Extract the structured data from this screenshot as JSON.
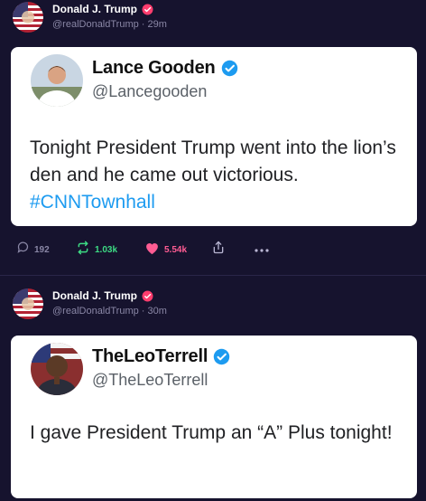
{
  "posts": [
    {
      "author": "Donald J. Trump",
      "handle": "@realDonaldTrump",
      "time": "29m",
      "card": {
        "name": "Lance Gooden",
        "handle": "@Lancegooden",
        "text": "Tonight President Trump went into the lion’s den and he came out victorious.",
        "hashtag": "#CNNTownhall"
      },
      "actions": {
        "replies": "192",
        "reposts": "1.03k",
        "likes": "5.54k"
      }
    },
    {
      "author": "Donald J. Trump",
      "handle": "@realDonaldTrump",
      "time": "30m",
      "card": {
        "name": "TheLeoTerrell",
        "handle": "@TheLeoTerrell",
        "text": "I gave President Trump an “A” Plus tonight!"
      }
    }
  ],
  "colors": {
    "background": "#16132e",
    "verified_red": "#ff3d6e",
    "verified_blue": "#1d9bf0",
    "repost_green": "#3ddc84",
    "like_pink": "#ff5c93",
    "muted": "#8a87a6"
  },
  "icons": [
    "flag-avatar",
    "verified-badge-icon",
    "reply-icon",
    "repost-icon",
    "heart-icon",
    "share-icon",
    "more-icon"
  ]
}
